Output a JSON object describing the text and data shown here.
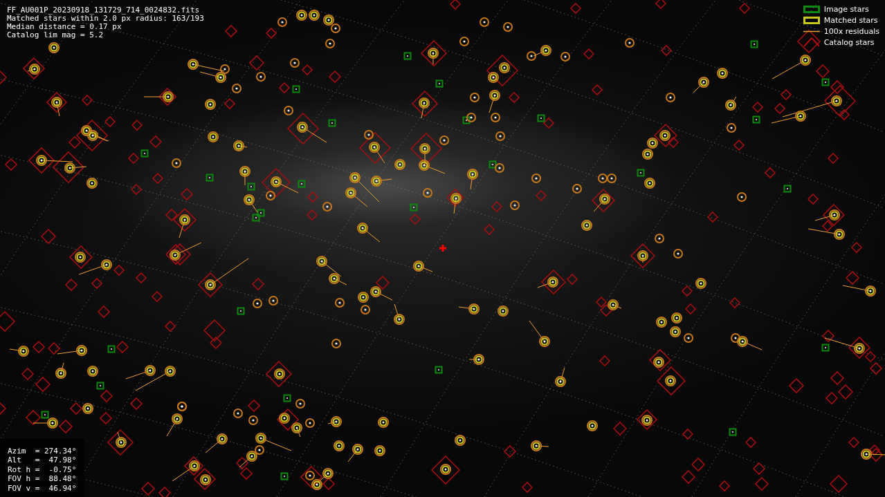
{
  "header_lines": [
    "FF_AU001P_20230918_131729_714_0024832.fits",
    "Matched stars within 2.0 px radius: 163/193",
    "Median distance = 0.17 px",
    "Catalog lim mag = 5.2"
  ],
  "legend": [
    {
      "kind": "image",
      "label": "Image stars"
    },
    {
      "kind": "matched",
      "label": "Matched stars"
    },
    {
      "kind": "residual",
      "label": "100x residuals"
    },
    {
      "kind": "catalog",
      "label": "Catalog stars"
    }
  ],
  "pointing_lines": [
    "Azim  = 274.34°",
    "Alt   =  47.98°",
    "Rot h =  -0.75°",
    "FOV h =  88.48°",
    "FOV v =  46.94°"
  ]
}
